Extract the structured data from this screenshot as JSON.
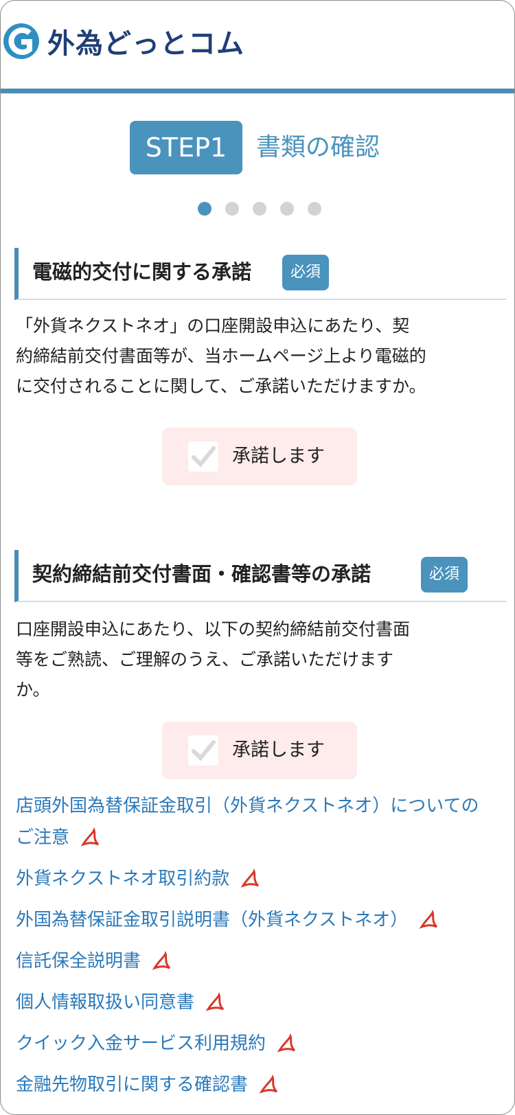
{
  "brand": {
    "name": "外為どっとコム"
  },
  "colors": {
    "primary": "#4a93bd",
    "agree_bg": "#fdeceb",
    "link": "#2b79b9",
    "navy": "#1f3f77"
  },
  "step": {
    "badge": "STEP1",
    "title": "書類の確認",
    "total_steps": 5,
    "current_step": 1
  },
  "sections": [
    {
      "title": "電磁的交付に関する承諾",
      "required_label": "必須",
      "description_lines": [
        "「外貨ネクストネオ」の口座開設申込にあたり、契",
        "約締結前交付書面等が、当ホームページ上より電磁的",
        "に交付されることに関して、ご承諾いただけますか。"
      ],
      "agree_label": "承諾します",
      "checked": false
    },
    {
      "title": "契約締結前交付書面・確認書等の承諾",
      "required_label": "必須",
      "description_lines": [
        "口座開設申込にあたり、以下の契約締結前交付書面",
        "等をご熟読、ご理解のうえ、ご承諾いただけます",
        "か。"
      ],
      "agree_label": "承諾します",
      "checked": false
    }
  ],
  "documents": [
    {
      "line1": "店頭外国為替保証金取引（外貨ネクストネオ）についての",
      "line2": "ご注意",
      "icon": "pdf-icon"
    },
    {
      "line1": "外貨ネクストネオ取引約款",
      "icon": "pdf-icon"
    },
    {
      "line1": "外国為替保証金取引説明書（外貨ネクストネオ）",
      "icon": "pdf-icon"
    },
    {
      "line1": "信託保全説明書",
      "icon": "pdf-icon"
    },
    {
      "line1": "個人情報取扱い同意書",
      "icon": "pdf-icon"
    },
    {
      "line1": "クイック入金サービス利用規約",
      "icon": "pdf-icon"
    },
    {
      "line1": "金融先物取引に関する確認書",
      "icon": "pdf-icon"
    }
  ]
}
